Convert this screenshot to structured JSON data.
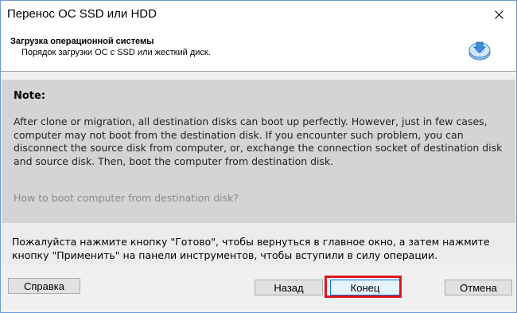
{
  "window": {
    "title": "Перенос ОС SSD или HDD"
  },
  "header": {
    "title": "Загрузка операционной системы",
    "subtitle": "Порядок загрузки ОС с SSD или жесткий диск.",
    "icon": "disk-download-icon"
  },
  "note": {
    "title": "Note:",
    "text": "After clone or migration, all destination disks can boot up perfectly. However, just in few cases, computer may not boot from the destination disk. If you encounter such problem, you can disconnect the source disk from computer, or, exchange the connection socket of destination disk and source disk. Then, boot the computer from destination disk.",
    "link": "How to boot computer from destination disk?"
  },
  "instructions": "Пожалуйста нажмите кнопку \"Готово\", чтобы вернуться в главное окно, а затем нажмите кнопку \"Применить\" на панели инструментов, чтобы вступили в силу операции.",
  "buttons": {
    "help": "Справка",
    "back": "Назад",
    "finish": "Конец",
    "cancel": "Отмена"
  },
  "colors": {
    "highlight": "#e0141c",
    "accent": "#0078d7"
  }
}
